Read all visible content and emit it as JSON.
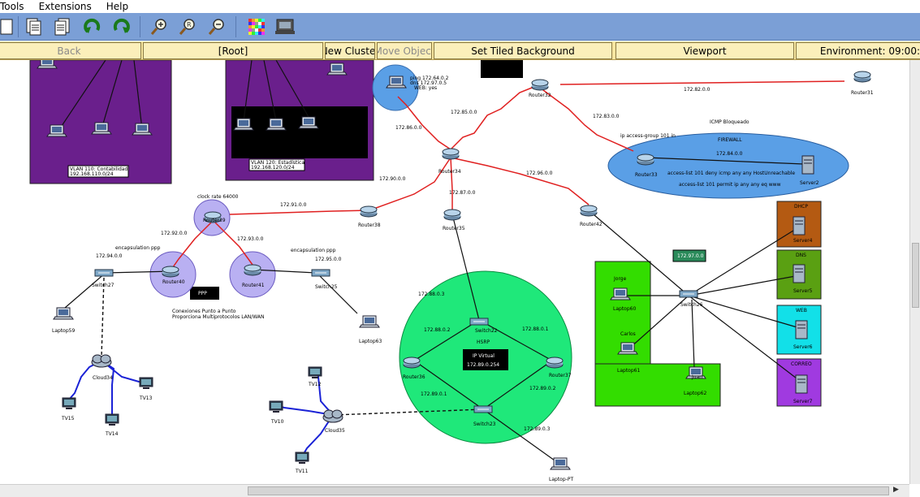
{
  "menu": {
    "items": [
      "Tools",
      "Extensions",
      "Help"
    ]
  },
  "toolbar": {
    "icons": [
      "page-copy-icon",
      "page-list-icon",
      "undo-icon",
      "redo-icon",
      "zoom-in-icon",
      "zoom-reset-icon",
      "zoom-out-icon",
      "palette-icon",
      "device-dialog-icon"
    ]
  },
  "logical": {
    "back": "Back",
    "root": "[Root]",
    "new_cluster": "New Cluster",
    "move_object": "Move Object",
    "tiled_bg": "Set Tiled Background",
    "viewport": "Viewport",
    "environment": "Environment: 09:00:"
  },
  "canvas": {
    "zones": {
      "vlan110": "VLAN 110: Contabilidad",
      "vlan110_net": "192.168.110.0/24",
      "vlan120": "VLAN 120: Estadística",
      "vlan120_net": "192.168.120.0/24",
      "ping_box": "ping 172.64.0.2",
      "ping_dns": "dns 172.97.0.5",
      "ping_web": "WEB: yes",
      "firewall_title": "ICMP Bloqueado",
      "firewall": "FIREWALL",
      "acl_group": "ip access-group 101 in",
      "acl1": "access-list 101 deny icmp any any HostUnreachable",
      "acl2": "access-list 101 permit ip any any eq www",
      "clock_rate": "clock rate 64000",
      "encap1": "encapsulation ppp",
      "encap2": "encapsulation ppp",
      "ppp": "PPP",
      "ppp_desc1": "Conexiones Punto a Punto",
      "ppp_desc2": "Proporciona Multiprotocolos LAN/WAN",
      "hsrp": "HSRP",
      "ip_virtual": "IP Virtual",
      "ip_virtual_val": "172.89.0.254",
      "net_172_97": "172.97.0.0"
    },
    "networks": {
      "n8": "172.82.0.0",
      "n85": "172.85.0.0",
      "n86": "172.86.0.0",
      "n83": "172.83.0.0",
      "n84": "172.84.0.0",
      "n90": "172.90.0.0",
      "n96": "172.96.0.0",
      "n87": "172.87.0.0",
      "n91": "172.91.0.0",
      "n92": "172.92.0.0",
      "n93": "172.93.0.0",
      "n94": "172.94.0.0",
      "n95": "172.95.0.0",
      "n88": "172.88.0.3",
      "n88b": "172.88.0.2",
      "n88c": "172.88.0.1",
      "n89": "172.89.0.1",
      "n89b": "172.89.0.2",
      "n89c": "172.89.0.3"
    },
    "devices": {
      "router31": "Router31",
      "router32": "Router32",
      "router33": "Router33",
      "router34": "Router34",
      "router35": "Router35",
      "router36": "Router36",
      "router37": "Router37",
      "router38": "Router38",
      "router39": "Router39",
      "router40": "Router40",
      "router41": "Router41",
      "router42": "Router42",
      "switch22": "Switch22",
      "switch23": "Switch23",
      "switch25": "Switch25",
      "switch26": "Switch26",
      "switch27": "Switch27",
      "server2": "Server2",
      "server4": "Server4",
      "server5": "Server5",
      "server6": "Server6",
      "server7": "Server7",
      "dhcp": "DHCP",
      "dns": "DNS",
      "web": "WEB",
      "correo": "CORREO",
      "jorge": "Jorge",
      "carlos": "Carlos",
      "juan": "Juan",
      "laptop59": "Laptop59",
      "laptop60": "Laptop60",
      "laptop61": "Laptop61",
      "laptop62": "Laptop62",
      "laptop63": "Laptop63",
      "laptop_pt": "Laptop-PT",
      "cloud34": "Cloud34",
      "cloud35": "Cloud35",
      "tv10": "TV10",
      "tv11": "TV11",
      "tv12": "TV12",
      "tv13": "TV13",
      "tv14": "TV14",
      "tv15": "TV15"
    }
  },
  "colors": {
    "toolbar": "#7b9fd6",
    "logical_bar": "#f7e6a0",
    "vlan_zone": "#6a1f8c",
    "firewall_zone": "#5a9fe6",
    "hsrp_zone": "#1fe87a",
    "green_zone": "#33dd00",
    "serial_link": "#e02020",
    "coax_link": "#1a22d6"
  }
}
